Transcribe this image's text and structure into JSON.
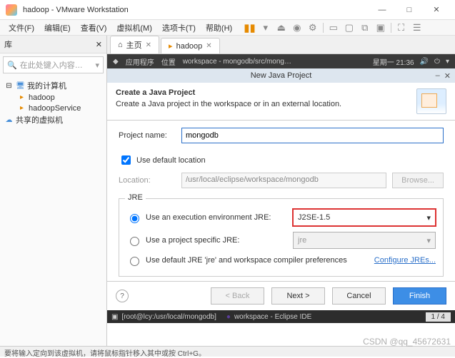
{
  "window": {
    "title": "hadoop - VMware Workstation",
    "min": "—",
    "max": "□",
    "close": "✕"
  },
  "menu": {
    "file": "文件(F)",
    "edit": "编辑(E)",
    "view": "查看(V)",
    "vm": "虚拟机(M)",
    "tabs": "选项卡(T)",
    "help": "帮助(H)"
  },
  "sidebar": {
    "title": "库",
    "search_ph": "在此处键入内容…",
    "items": [
      {
        "label": "我的计算机",
        "type": "root"
      },
      {
        "label": "hadoop",
        "type": "vm"
      },
      {
        "label": "hadoopService",
        "type": "vm"
      },
      {
        "label": "共享的虚拟机",
        "type": "root"
      }
    ]
  },
  "tabs": {
    "home": "主页",
    "hadoop": "hadoop"
  },
  "guestbar": {
    "apps": "应用程序",
    "loc_label": "位置",
    "loc_path": "workspace - mongodb/src/mong…",
    "time": "星期一 21:36"
  },
  "dialog": {
    "title": "New Java Project",
    "header_title": "Create a Java Project",
    "header_sub": "Create a Java project in the workspace or in an external location.",
    "project_label": "Project name:",
    "project_value": "mongodb",
    "use_default": "Use default location",
    "location_label": "Location:",
    "location_value": "/usr/local/eclipse/workspace/mongodb",
    "browse": "Browse...",
    "jre_legend": "JRE",
    "r_env": "Use an execution environment JRE:",
    "r_env_val": "J2SE-1.5",
    "r_proj": "Use a project specific JRE:",
    "r_proj_val": "jre",
    "r_def": "Use default JRE 'jre' and workspace compiler preferences",
    "configure": "Configure JREs...",
    "back": "< Back",
    "next": "Next >",
    "cancel": "Cancel",
    "finish": "Finish"
  },
  "taskbar": {
    "term": "[root@lcy:/usr/local/mongodb]",
    "ide": "workspace - Eclipse IDE",
    "page": "1 / 4"
  },
  "statusbar": "要将输入定向到该虚拟机，请将鼠标指针移入其中或按 Ctrl+G。",
  "watermark": "CSDN @qq_45672631"
}
